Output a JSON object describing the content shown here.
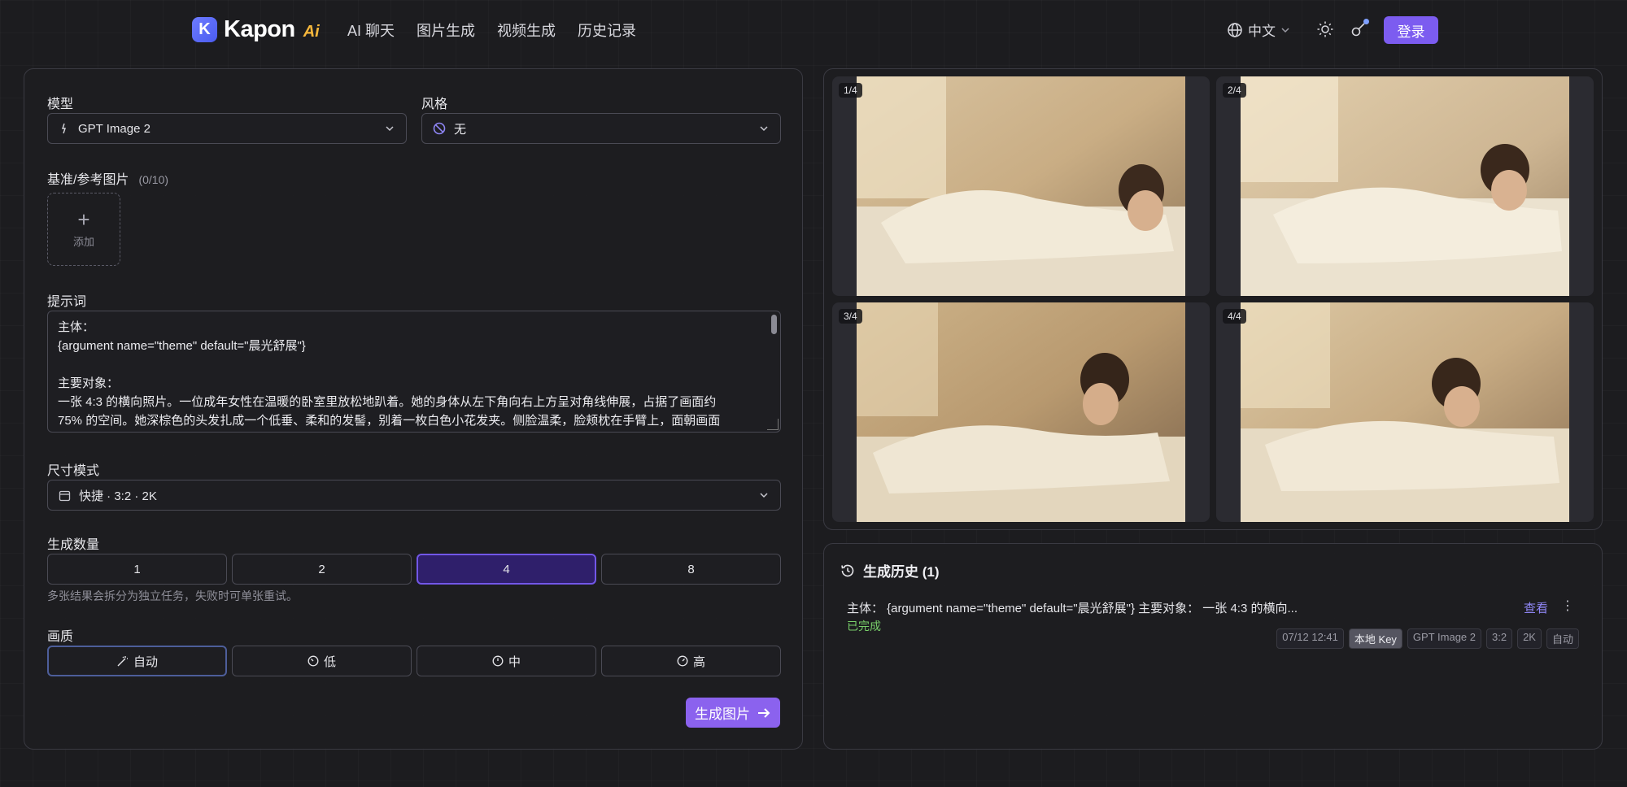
{
  "header": {
    "logo_mark": "K",
    "logo_text": "Kapon",
    "logo_ai": "Ai",
    "nav": [
      "AI 聊天",
      "图片生成",
      "视频生成",
      "历史记录"
    ],
    "language": "中文",
    "login_label": "登录"
  },
  "form": {
    "model_label": "模型",
    "model_value": "GPT Image 2",
    "style_label": "风格",
    "style_value": "无",
    "ref_label": "基准/参考图片",
    "ref_count": "(0/10)",
    "add_label": "添加",
    "prompt_label": "提示词",
    "prompt_lines": [
      "主体：",
      "{argument name=\"theme\" default=\"晨光舒展\"}",
      "",
      "主要对象：",
      "一张 4:3 的横向照片。一位成年女性在温暖的卧室里放松地趴着。她的身体从左下角向右上方呈对角线伸展，占据了画面约",
      "75% 的空间。她深棕色的头发扎成一个低垂、柔和的发髻，别着一枚白色小花发夹。侧脸温柔，脸颊枕在手臂上，面朝画面"
    ],
    "size_label": "尺寸模式",
    "size_value": "快捷 · 3:2 · 2K",
    "count_label": "生成数量",
    "count_options": [
      "1",
      "2",
      "4",
      "8"
    ],
    "count_selected": "4",
    "count_hint": "多张结果会拆分为独立任务，失败时可单张重试。",
    "quality_label": "画质",
    "quality_options": [
      "自动",
      "低",
      "中",
      "高"
    ],
    "quality_selected": "自动",
    "generate_label": "生成图片"
  },
  "results": {
    "badges": [
      "1/4",
      "2/4",
      "3/4",
      "4/4"
    ]
  },
  "history": {
    "title": "生成历史 (1)",
    "item_text": "主体： {argument name=\"theme\" default=\"晨光舒展\"} 主要对象： 一张 4:3 的横向...",
    "status": "已完成",
    "view_label": "查看",
    "tags": [
      "07/12 12:41",
      "本地 Key",
      "GPT Image 2",
      "3:2",
      "2K",
      "自动"
    ]
  },
  "colors": {
    "accent": "#7c5cf0",
    "success": "#79d06a",
    "background": "#1c1c1f"
  }
}
